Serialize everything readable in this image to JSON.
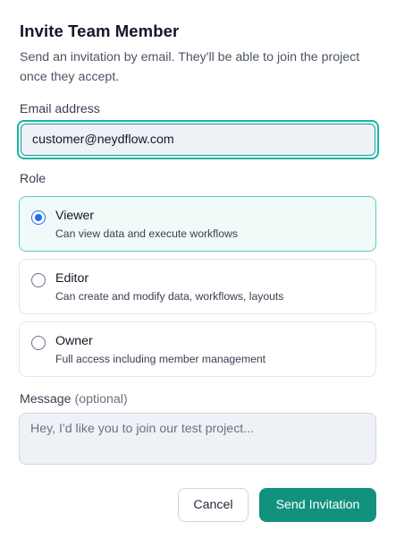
{
  "dialog": {
    "title": "Invite Team Member",
    "subtitle": "Send an invitation by email. They'll be able to join the project once they accept."
  },
  "email": {
    "label": "Email address",
    "value": "customer@neydflow.com"
  },
  "role": {
    "label": "Role",
    "selected": "Viewer",
    "options": [
      {
        "name": "Viewer",
        "description": "Can view data and execute workflows",
        "checked": true
      },
      {
        "name": "Editor",
        "description": "Can create and modify data, workflows, layouts",
        "checked": false
      },
      {
        "name": "Owner",
        "description": "Full access including member management",
        "checked": false
      }
    ]
  },
  "message": {
    "label": "Message",
    "optional_label": "(optional)",
    "placeholder": "Hey, I'd like you to join our test project...",
    "value": ""
  },
  "actions": {
    "cancel_label": "Cancel",
    "send_label": "Send Invitation"
  },
  "colors": {
    "accent": "#13917f",
    "focus_ring": "#14b8a6",
    "radio_selected": "#1d6ff2",
    "selected_card_bg": "#f0faf8",
    "input_bg": "#eef2f7"
  },
  "icons": {
    "radio_checked": "radio-checked-icon",
    "radio_unchecked": "radio-unchecked-icon"
  }
}
